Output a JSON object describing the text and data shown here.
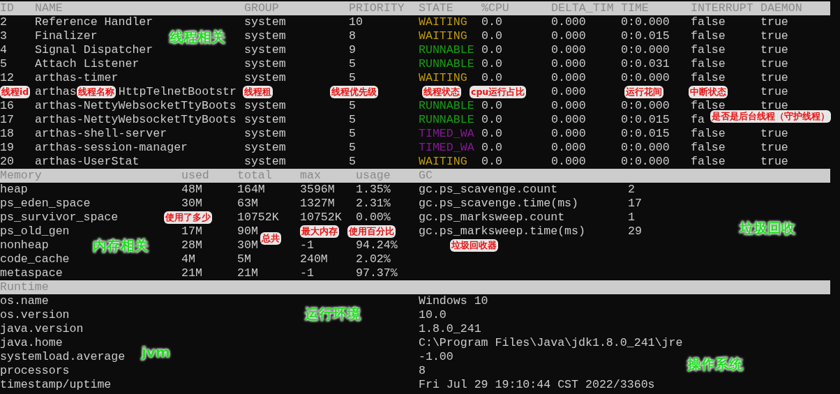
{
  "threads": {
    "columns": [
      "ID",
      "NAME",
      "GROUP",
      "PRIORITY",
      "STATE",
      "%CPU",
      "DELTA_TIM",
      "TIME",
      "INTERRUPT",
      "DAEMON"
    ],
    "rows": [
      {
        "id": "2",
        "name": "Reference Handler",
        "group": "system",
        "priority": "10",
        "state": "WAITING",
        "color": "#c19c00",
        "cpu": "0.0",
        "delta": "0.000",
        "time": "0:0.000",
        "interrupt": "false",
        "daemon": "true"
      },
      {
        "id": "3",
        "name": "Finalizer",
        "group": "system",
        "priority": "8",
        "state": "WAITING",
        "color": "#c19c00",
        "cpu": "0.0",
        "delta": "0.000",
        "time": "0:0.015",
        "interrupt": "false",
        "daemon": "true"
      },
      {
        "id": "4",
        "name": "Signal Dispatcher",
        "group": "system",
        "priority": "9",
        "state": "RUNNABLE",
        "color": "#13a10e",
        "cpu": "0.0",
        "delta": "0.000",
        "time": "0:0.000",
        "interrupt": "false",
        "daemon": "true"
      },
      {
        "id": "5",
        "name": "Attach Listener",
        "group": "system",
        "priority": "5",
        "state": "RUNNABLE",
        "color": "#13a10e",
        "cpu": "0.0",
        "delta": "0.000",
        "time": "0:0.031",
        "interrupt": "false",
        "daemon": "true"
      },
      {
        "id": "12",
        "name": "arthas-timer",
        "group": "system",
        "priority": "5",
        "state": "WAITING",
        "color": "#c19c00",
        "cpu": "0.0",
        "delta": "0.000",
        "time": "0:0.000",
        "interrupt": "false",
        "daemon": "true"
      },
      {
        "name": "arthas",
        "name_tail": "HttpTelnetBootstr",
        "delta": "0.000",
        "daemon": "true"
      },
      {
        "id": "16",
        "name": "arthas-NettyWebsocketTtyBoots",
        "group": "system",
        "priority": "5",
        "state": "RUNNABLE",
        "color": "#13a10e",
        "cpu": "0.0",
        "delta": "0.000",
        "time": "0:0.000",
        "interrupt": "false",
        "daemon": "true"
      },
      {
        "id": "17",
        "name": "arthas-NettyWebsocketTtyBoots",
        "group": "system",
        "priority": "5",
        "state": "RUNNABLE",
        "color": "#13a10e",
        "cpu": "0.0",
        "delta": "0.000",
        "time": "0:0.015",
        "interrupt": "fa"
      },
      {
        "id": "18",
        "name": "arthas-shell-server",
        "group": "system",
        "priority": "5",
        "state": "TIMED_WA",
        "color": "#881798",
        "cpu": "0.0",
        "delta": "0.000",
        "time": "0:0.015",
        "interrupt": "false",
        "daemon": "true"
      },
      {
        "id": "19",
        "name": "arthas-session-manager",
        "group": "system",
        "priority": "5",
        "state": "TIMED_WA",
        "color": "#881798",
        "cpu": "0.0",
        "delta": "0.000",
        "time": "0:0.000",
        "interrupt": "false",
        "daemon": "true"
      },
      {
        "id": "20",
        "name": "arthas-UserStat",
        "group": "system",
        "priority": "5",
        "state": "WAITING",
        "color": "#c19c00",
        "cpu": "0.0",
        "delta": "0.000",
        "time": "0:0.000",
        "interrupt": "false",
        "daemon": "true"
      }
    ]
  },
  "memory": {
    "columns": [
      "Memory",
      "used",
      "total",
      "max",
      "usage"
    ],
    "rows": [
      {
        "name": "heap",
        "used": "48M",
        "total": "164M",
        "max": "3596M",
        "usage": "1.35%"
      },
      {
        "name": "ps_eden_space",
        "used": "30M",
        "total": "63M",
        "max": "1327M",
        "usage": "2.31%"
      },
      {
        "name": "ps_survivor_space",
        "total": "10752K",
        "max": "10752K",
        "usage": "0.00%"
      },
      {
        "name": "ps_old_gen",
        "used": "17M",
        "total": "90M"
      },
      {
        "name": "nonheap",
        "used": "28M",
        "total": "30M",
        "max": "-1",
        "usage": "94.24%"
      },
      {
        "name": "code_cache",
        "used": "4M",
        "total": "5M",
        "max": "240M",
        "usage": "2.02%"
      },
      {
        "name": "metaspace",
        "used": "21M",
        "total": "21M",
        "max": "-1",
        "usage": "97.37%"
      }
    ]
  },
  "gc": {
    "title": "GC",
    "rows": [
      {
        "name": "gc.ps_scavenge.count",
        "value": "2"
      },
      {
        "name": "gc.ps_scavenge.time(ms)",
        "value": "17"
      },
      {
        "name": "gc.ps_marksweep.count",
        "value": "1"
      },
      {
        "name": "gc.ps_marksweep.time(ms)",
        "value": "29"
      }
    ]
  },
  "runtime": {
    "title": "Runtime",
    "rows": [
      {
        "name": "os.name",
        "value": "Windows 10"
      },
      {
        "name": "os.version",
        "value": "10.0"
      },
      {
        "name": "java.version",
        "value": "1.8.0_241"
      },
      {
        "name": "java.home",
        "value": "C:\\Program Files\\Java\\jdk1.8.0_241\\jre"
      },
      {
        "name": "systemload.average",
        "value": "-1.00"
      },
      {
        "name": "processors",
        "value": "8"
      },
      {
        "name": "timestamp/uptime",
        "value": "Fri Jul 29 19:10:44 CST 2022/3360s"
      }
    ]
  },
  "annotations": [
    {
      "text": "线程相关",
      "kind": "heading"
    },
    {
      "text": "线程id",
      "kind": "note"
    },
    {
      "text": "线程名称",
      "kind": "note"
    },
    {
      "text": "线程租",
      "kind": "note"
    },
    {
      "text": "线程优先级",
      "kind": "note"
    },
    {
      "text": "线程状态",
      "kind": "note"
    },
    {
      "text": "cpu运行占比",
      "kind": "note"
    },
    {
      "text": "运行花间",
      "kind": "note"
    },
    {
      "text": "中断状态",
      "kind": "note"
    },
    {
      "text": "是否是后台线程（守护线程）",
      "kind": "note"
    },
    {
      "text": "使用了多少",
      "kind": "note"
    },
    {
      "text": "总共",
      "kind": "note"
    },
    {
      "text": "最大内存",
      "kind": "note"
    },
    {
      "text": "使用百分比",
      "kind": "note"
    },
    {
      "text": "内存相关",
      "kind": "heading"
    },
    {
      "text": "垃圾回收器",
      "kind": "note"
    },
    {
      "text": "垃圾回收",
      "kind": "heading"
    },
    {
      "text": "运行环境",
      "kind": "heading"
    },
    {
      "text": "jvm",
      "kind": "heading"
    },
    {
      "text": "操作系统",
      "kind": "heading"
    }
  ]
}
